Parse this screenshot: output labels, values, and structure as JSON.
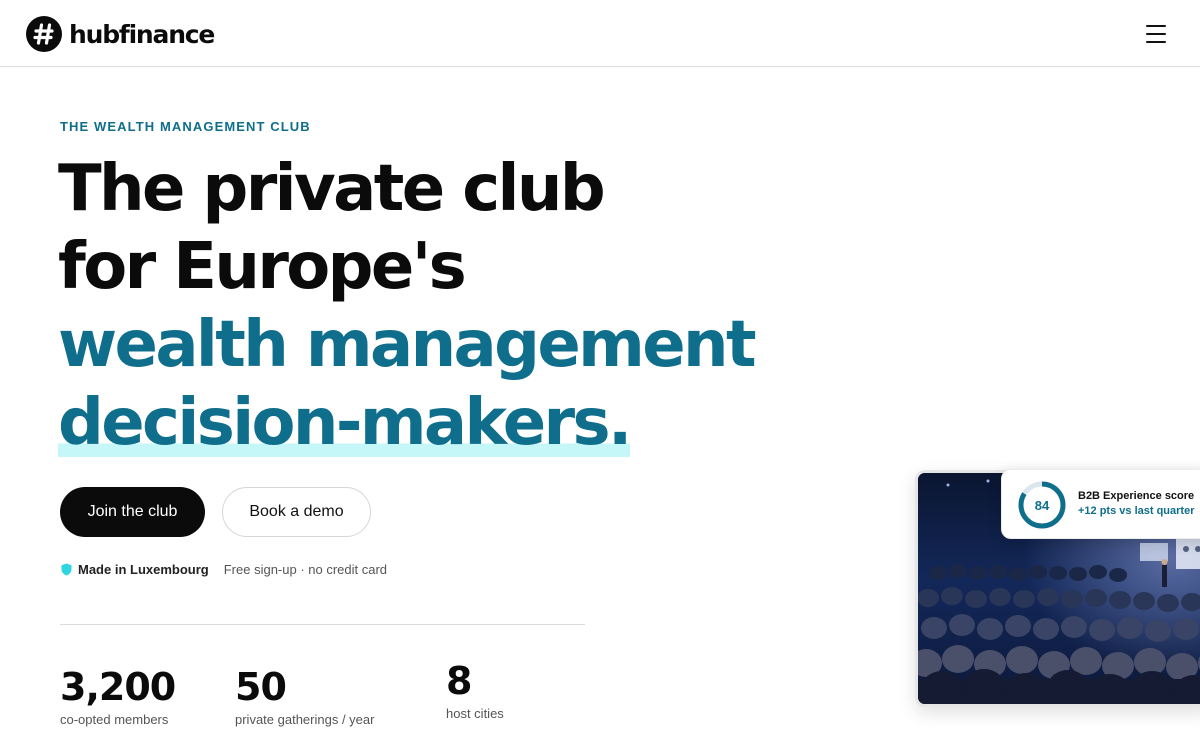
{
  "brand": {
    "name": "hubfinance",
    "mark_glyph": "#",
    "dark": "#0b0b0b",
    "accent": "#0f6e8c",
    "highlight": "#c5f6f8"
  },
  "header": {
    "menu_icon": "hamburger-menu-icon"
  },
  "hero": {
    "eyebrow": "THE WEALTH MANAGEMENT CLUB",
    "headline_lines": [
      "The private club",
      "for Europe's",
      "wealth management",
      "decision-makers."
    ],
    "primary_cta": "Join the club",
    "secondary_cta": "Book a demo",
    "badge_icon": "shield-icon",
    "badge_text": "Made in Luxembourg",
    "note": "Free sign-up · no credit card"
  },
  "stats": [
    {
      "value": "3,200",
      "label": "co-opted members"
    },
    {
      "value": "50",
      "label": "private gatherings / year"
    },
    {
      "value": "8",
      "label": "host cities"
    }
  ],
  "score_card": {
    "value": "84",
    "fraction": 0.84,
    "title": "B2B Experience score",
    "delta": "+12 pts vs last quarter"
  },
  "photo": {
    "subject": "conference-audience-photo"
  }
}
